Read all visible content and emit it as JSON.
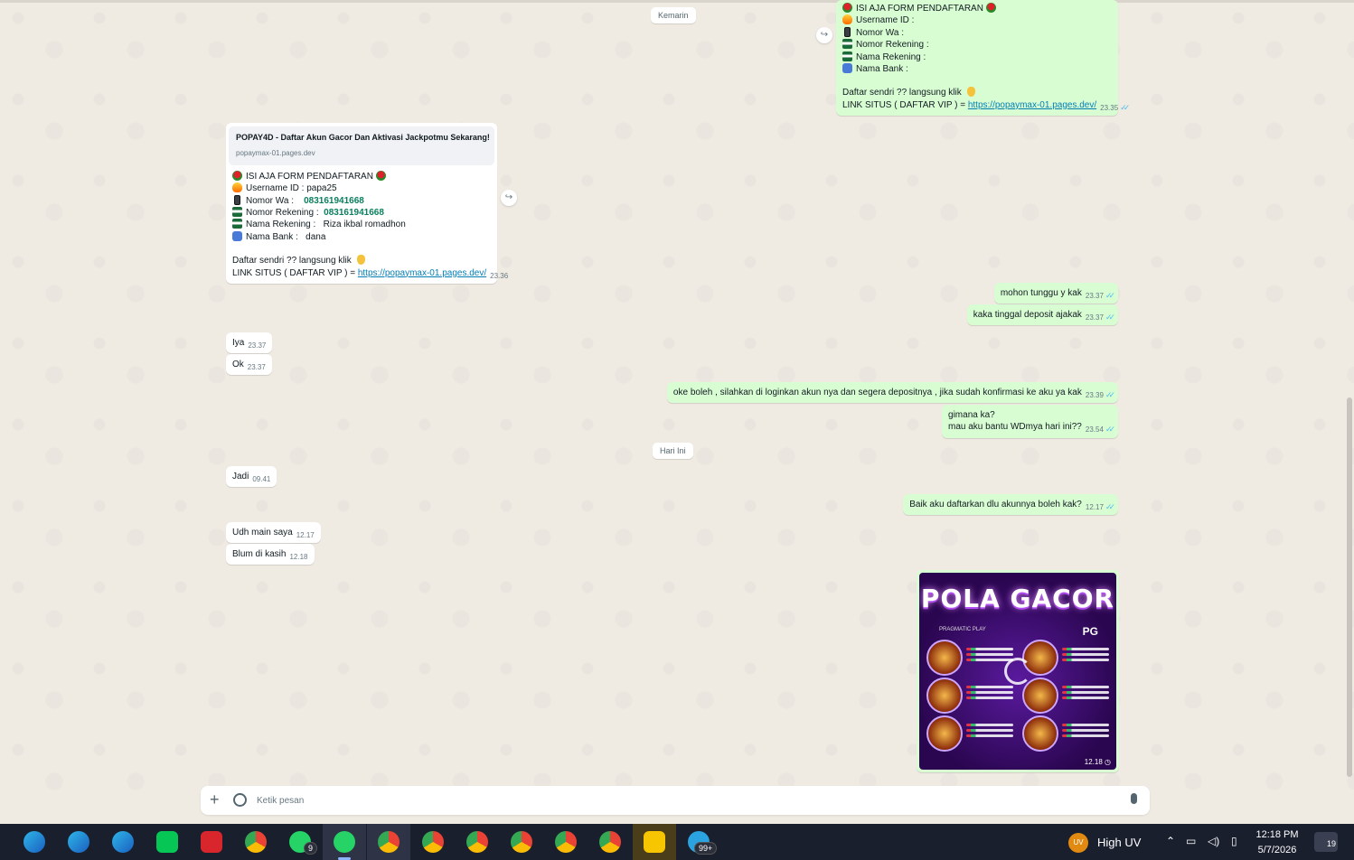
{
  "day_dividers": {
    "yesterday": "Kemarin",
    "today": "Hari Ini"
  },
  "forwarded_template": {
    "lines": [
      {
        "emoji": "rose",
        "text": "ISI AJA FORM PENDAFTARAN "
      },
      {
        "emoji": "fire",
        "text": "Username ID :"
      },
      {
        "emoji": "phone",
        "text": "Nomor Wa :"
      },
      {
        "emoji": "bank",
        "text": "Nomor Rekening :"
      },
      {
        "emoji": "bank",
        "text": "Nama Rekening :"
      },
      {
        "emoji": "atm",
        "text": "Nama Bank :"
      }
    ],
    "cta": "Daftar sendri ?? langsung klik ",
    "link_prefix": "LINK SITUS ( DAFTAR VIP )  = ",
    "link": "https://popaymax-01.pages.dev/",
    "time": "23.35"
  },
  "filled_form": {
    "preview_title": "POPAY4D - Daftar Akun Gacor Dan Aktivasi Jackpotmu Sekarang!",
    "preview_domain": "popaymax-01.pages.dev",
    "header": "ISI AJA FORM PENDAFTARAN ",
    "username_label": "Username ID : ",
    "username_value": "papa25",
    "wa_label": "Nomor Wa :",
    "wa_value": "083161941668",
    "rek_label": "Nomor Rekening :",
    "rek_value": "083161941668",
    "nama_rek_label": "Nama Rekening :",
    "nama_rek_value": "Riza ikbal romadhon",
    "bank_label": "Nama Bank :",
    "bank_value": "dana",
    "cta": "Daftar sendri ?? langsung klik ",
    "link_prefix": "LINK SITUS ( DAFTAR VIP )  = ",
    "link": "https://popaymax-01.pages.dev/",
    "time": "23.36"
  },
  "messages": {
    "m1": {
      "text": "mohon tunggu y kak",
      "time": "23.37"
    },
    "m2": {
      "text": "kaka tinggal deposit ajakak",
      "time": "23.37"
    },
    "m3": {
      "text": "Iya",
      "time": "23.37"
    },
    "m4": {
      "text": "Ok",
      "time": "23.37"
    },
    "m5": {
      "text": "oke boleh , silahkan di loginkan akun nya dan segera depositnya , jika sudah konfirmasi ke aku ya kak",
      "time": "23.39"
    },
    "m6": {
      "line1": "gimana ka?",
      "line2": "mau aku bantu WDmya hari ini??",
      "time": "23.54"
    },
    "m7": {
      "text": "Jadi",
      "time": "09.41"
    },
    "m8": {
      "text": "Baik aku daftarkan dlu akunnya boleh kak?",
      "time": "12.17"
    },
    "m9": {
      "text": "Udh main saya",
      "time": "12.17"
    },
    "m10": {
      "text": "Blum di kasih",
      "time": "12.18"
    }
  },
  "image_message": {
    "title": "POLA GACOR",
    "brand_left": "PRAGMATIC PLAY",
    "brand_right": "PG",
    "time": "12.18"
  },
  "composer": {
    "placeholder": "Ketik pesan"
  },
  "taskbar": {
    "whatsapp_badge": "9",
    "telegram_badge": "99+",
    "weather_badge": "UV",
    "weather": "High UV",
    "time": "12:18 PM",
    "date": "5/7/2026",
    "notifications": "19"
  },
  "colors": {
    "chat_bg": "#efeae2",
    "outgoing": "#d9fdd3",
    "incoming": "#ffffff",
    "link": "#027eb5",
    "read_ticks": "#53bdeb",
    "taskbar": "#1a1f2e"
  }
}
